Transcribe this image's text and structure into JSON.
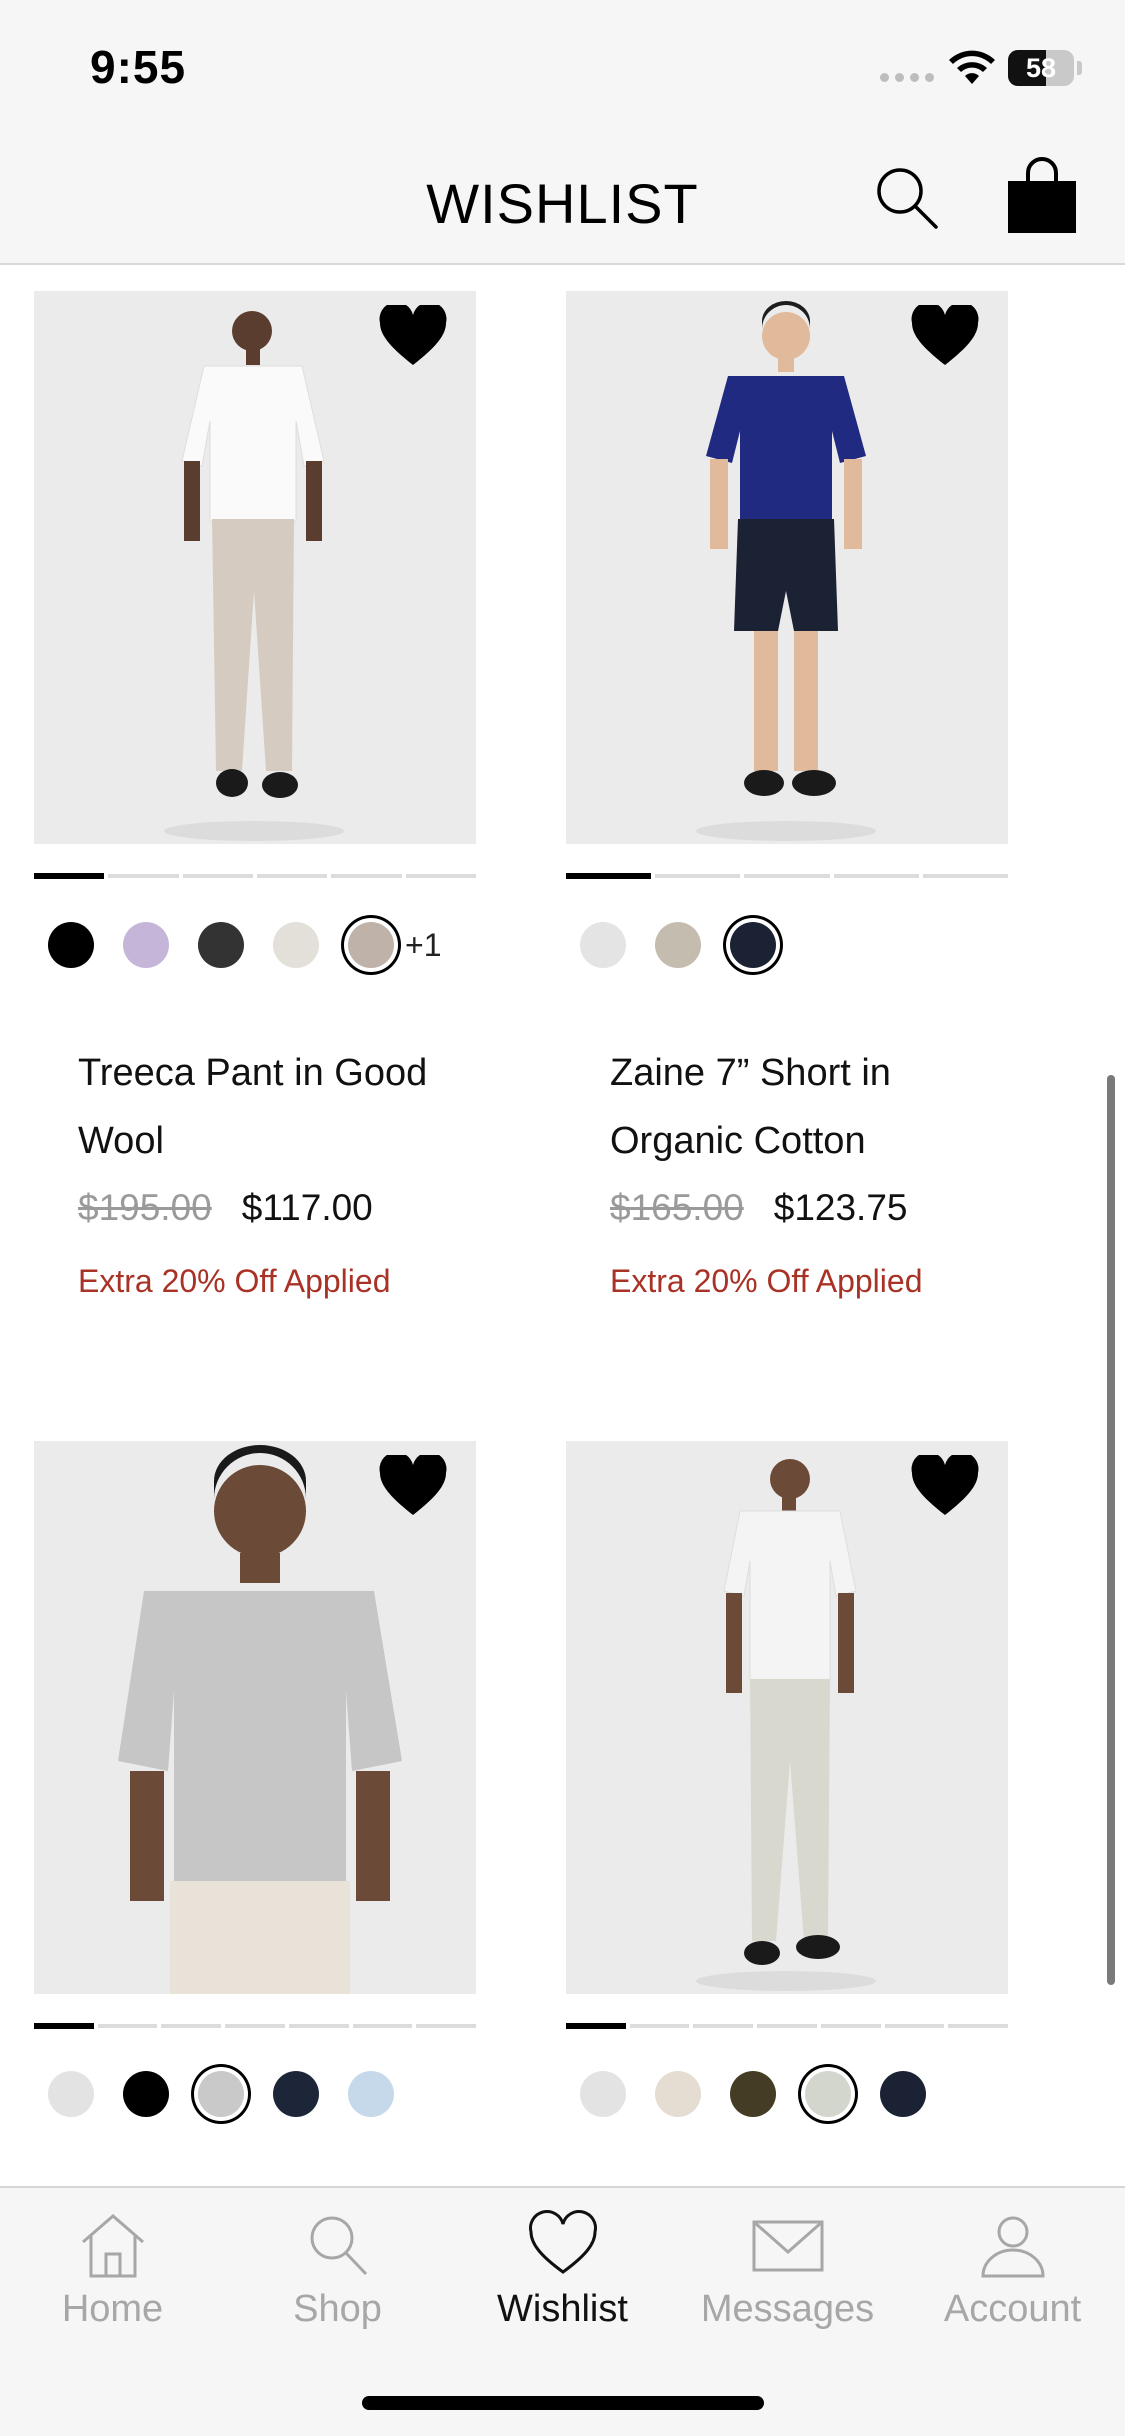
{
  "status_bar": {
    "time": "9:55",
    "battery": "58",
    "battery_level": 0.58
  },
  "header": {
    "title": "WISHLIST"
  },
  "products": [
    {
      "name": "Treeca Pant in Good Wool",
      "original_price": "$195.00",
      "sale_price": "$117.00",
      "promo": "Extra 20% Off Applied",
      "swatches": [
        "#000000",
        "#c5b6d9",
        "#333333",
        "#e3e0da",
        "#bfb2a8"
      ],
      "selected_swatch": 4,
      "more_colors": "+1",
      "pager_count": 6,
      "pager_active": 0,
      "image": "woman-white-shirt-beige-pants"
    },
    {
      "name": "Zaine 7” Short in Organic Cotton",
      "original_price": "$165.00",
      "sale_price": "$123.75",
      "promo": "Extra 20% Off Applied",
      "swatches": [
        "#e4e4e4",
        "#c4bcaf",
        "#1a2233"
      ],
      "selected_swatch": 2,
      "more_colors": "",
      "pager_count": 5,
      "pager_active": 0,
      "image": "man-navy-polo-navy-shorts"
    },
    {
      "name": "",
      "original_price": "",
      "sale_price": "",
      "promo": "",
      "swatches": [
        "#e3e3e3",
        "#000000",
        "#c9c9c9",
        "#1c2638",
        "#c6d9ea"
      ],
      "selected_swatch": 2,
      "more_colors": "",
      "pager_count": 7,
      "pager_active": 0,
      "image": "man-grey-polo"
    },
    {
      "name": "",
      "original_price": "",
      "sale_price": "",
      "promo": "",
      "swatches": [
        "#e3e3e3",
        "#e5ddd2",
        "#443c24",
        "#d3d6cd",
        "#1a2233"
      ],
      "selected_swatch": 3,
      "more_colors": "",
      "pager_count": 7,
      "pager_active": 0,
      "image": "man-white-polo-stone-pants"
    }
  ],
  "tabs": [
    {
      "label": "Home",
      "icon": "home-icon",
      "active": false
    },
    {
      "label": "Shop",
      "icon": "search-icon",
      "active": false
    },
    {
      "label": "Wishlist",
      "icon": "heart-icon",
      "active": true
    },
    {
      "label": "Messages",
      "icon": "envelope-icon",
      "active": false
    },
    {
      "label": "Account",
      "icon": "person-icon",
      "active": false
    }
  ],
  "colors": {
    "promo": "#a93226",
    "price_old": "#9a9a9a",
    "tab_inactive": "#a7a7a7",
    "bar_bg": "#f6f6f6"
  }
}
